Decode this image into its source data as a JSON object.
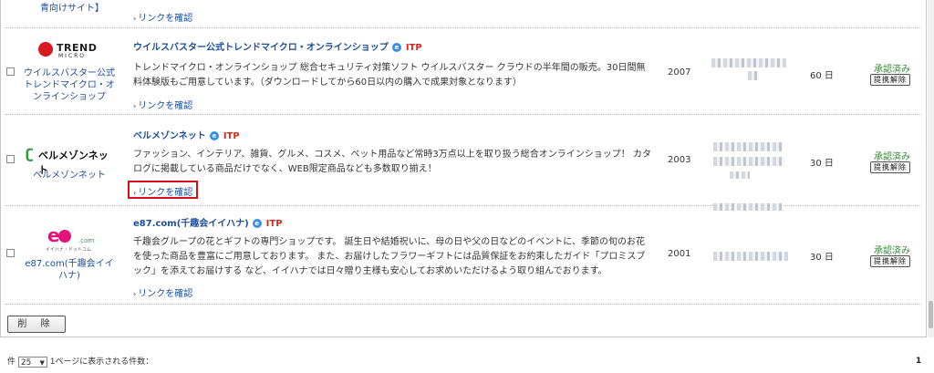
{
  "prev_row": {
    "tail_text": "青向けサイト】",
    "link": "リンクを確認"
  },
  "rows": [
    {
      "logo_text": "TREND MICRO",
      "logo_name": "ウイルスバスター公式トレンドマイクロ・オンラインショップ",
      "title": "ウイルスバスター公式トレンドマイクロ・オンラインショップ",
      "itp": "ITP",
      "description": "トレンドマイクロ・オンラインショップ 総合セキュリティ対策ソフト ウイルスバスター クラウドの半年間の販売。30日間無料体験版もご用意しています。（ダウンロードしてから60日以内の購入で成果対象となります）",
      "link": "リンクを確認",
      "year": "2007",
      "days": "60 日",
      "status": "承認済み",
      "unlink": "提携解除"
    },
    {
      "logo_text": "ベルメゾンネット",
      "logo_name": "ベルメゾンネット",
      "title": "ベルメゾンネット",
      "itp": "ITP",
      "description": "ファッション、インテリア、雑貨、グルメ、コスメ、ペット用品など常時3万点以上を取り扱う総合オンラインショップ！ カタログに掲載している商品だけでなく、WEB限定商品なども多数取り揃え！",
      "link": "リンクを確認",
      "year": "2003",
      "days": "30 日",
      "status": "承認済み",
      "unlink": "提携解除"
    },
    {
      "logo_text": "e87.com",
      "logo_sub": "イイハナ・ドットコム",
      "logo_name": "e87.com(千趣会イイハナ)",
      "title": "e87.com(千趣会イイハナ)",
      "itp": "ITP",
      "description": "千趣会グループの花とギフトの専門ショップです。 誕生日や結婚祝いに、母の日や父の日などのイベントに、季節の旬のお花を使った商品を豊富にご用意しております。 また、お届けしたフラワーギフトには品質保証をお約束したガイド「プロミスブック」を添えてお届けする など、イイハナでは日々贈り主様も安心してお求めいただけるよう取り組んでおります。",
      "link": "リンクを確認",
      "year": "2001",
      "days": "30 日",
      "status": "承認済み",
      "unlink": "提携解除"
    }
  ],
  "delete_button": "削 除",
  "footer": {
    "prefix": "件",
    "per_page": "25",
    "label": "1ページに表示される件数：",
    "page": "1"
  },
  "colors": {
    "link": "#1a4f9c",
    "itp": "#d4281c",
    "approved": "#2f8a2f",
    "highlight": "#d0121b"
  }
}
